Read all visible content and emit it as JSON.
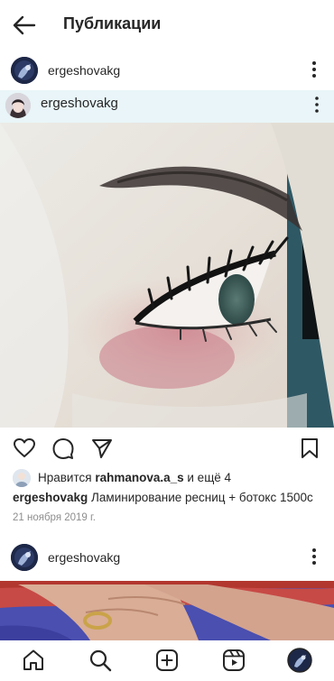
{
  "header": {
    "title": "Публикации",
    "back_icon": "arrow-left-icon"
  },
  "post1": {
    "username": "ergeshovakg",
    "inner_username": "ergeshovakg",
    "likes": {
      "prefix": "Нравится ",
      "liker": "rahmanova.a_s",
      "suffix": " и ещё 4"
    },
    "caption": {
      "username": "ergeshovakg",
      "text": " Ламинирование ресниц + ботокс 1500с"
    },
    "date": "21 ноября 2019 г."
  },
  "post2": {
    "username": "ergeshovakg"
  },
  "icons": {
    "actions": [
      "heart-icon",
      "comment-icon",
      "share-icon",
      "bookmark-icon"
    ],
    "nav": [
      "home-icon",
      "search-icon",
      "create-icon",
      "reels-icon",
      "profile-avatar"
    ]
  },
  "colors": {
    "text": "#262626",
    "secondary": "#8e8e8e",
    "background": "#ffffff"
  }
}
